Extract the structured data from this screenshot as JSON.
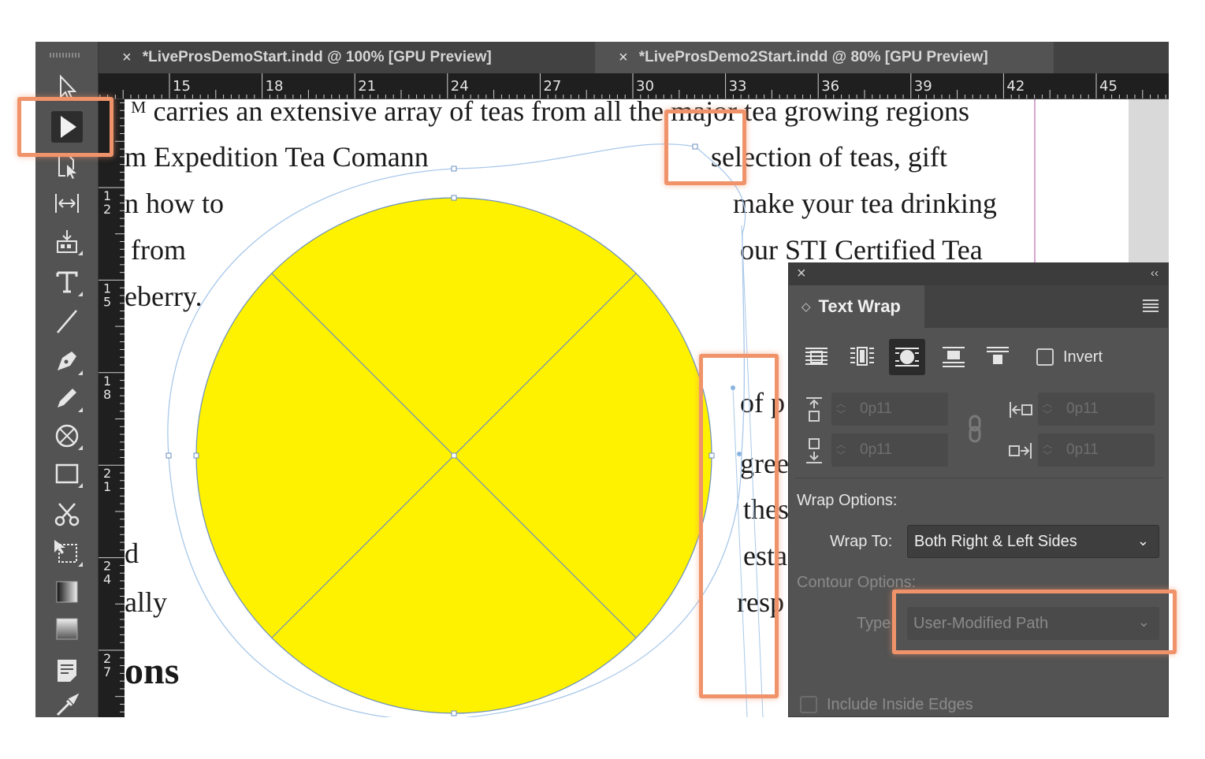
{
  "tabs": [
    {
      "label": "*LiveProsDemoStart.indd @ 100% [GPU Preview]",
      "active": false
    },
    {
      "label": "*LiveProsDemo2Start.indd @ 80% [GPU Preview]",
      "active": true
    }
  ],
  "ruler": {
    "h_labels": [
      "15",
      "18",
      "21",
      "24",
      "27",
      "30",
      "33",
      "36",
      "39",
      "42",
      "45"
    ],
    "v_labels": [
      [
        "1",
        "2"
      ],
      [
        "1",
        "5"
      ],
      [
        "1",
        "8"
      ],
      [
        "2",
        "1"
      ],
      [
        "2",
        "4"
      ],
      [
        "2",
        "7"
      ]
    ]
  },
  "tools": [
    {
      "name": "selection-tool",
      "icon": "hollow-arrow-icon"
    },
    {
      "name": "direct-selection-tool",
      "icon": "solid-arrow-icon",
      "active": true
    },
    {
      "name": "page-tool",
      "icon": "page-tool-icon"
    },
    {
      "name": "gap-tool",
      "icon": "gap-tool-icon"
    },
    {
      "name": "content-collector-tool",
      "icon": "content-collector-icon"
    },
    {
      "name": "type-tool",
      "icon": "type-icon"
    },
    {
      "name": "line-tool",
      "icon": "line-icon"
    },
    {
      "name": "pen-tool",
      "icon": "pen-icon"
    },
    {
      "name": "pencil-tool",
      "icon": "pencil-icon"
    },
    {
      "name": "frame-tool",
      "icon": "ellipse-frame-icon"
    },
    {
      "name": "rectangle-tool",
      "icon": "rectangle-icon"
    },
    {
      "name": "scissors-tool",
      "icon": "scissors-icon"
    },
    {
      "name": "free-transform-tool",
      "icon": "free-transform-icon"
    },
    {
      "name": "gradient-swatch-tool",
      "icon": "gradient-icon"
    },
    {
      "name": "gradient-feather-tool",
      "icon": "gradient-feather-icon"
    },
    {
      "name": "note-tool",
      "icon": "note-icon"
    },
    {
      "name": "eyedropper-tool",
      "icon": "eyedropper-icon"
    }
  ],
  "document": {
    "lines": [
      "ᴹ  carries an extensive array of teas from all the major tea growing regions",
      "m Expedition Tea Comann",
      "selection of teas, gift",
      "n how to",
      "make your tea drinking",
      "from",
      "our STI Certified Tea",
      "eberry.",
      "of p",
      "gree",
      "thes",
      "esta",
      "d",
      "resp",
      "ally",
      "ons"
    ]
  },
  "shape": {
    "fill_color": "#fff200",
    "path_color": "#8ab4e0"
  },
  "panel": {
    "title": "Text Wrap",
    "invert_label": "Invert",
    "offsets": {
      "top": "0p11",
      "bottom": "0p11",
      "left": "0p11",
      "right": "0p11"
    },
    "wrap_options_label": "Wrap Options:",
    "wrap_to_label": "Wrap To:",
    "wrap_to_value": "Both Right & Left Sides",
    "contour_options_label": "Contour Options:",
    "type_label": "Type:",
    "type_value": "User-Modified Path",
    "include_inside_edges_label": "Include Inside Edges",
    "wrap_buttons": [
      "no-text-wrap",
      "wrap-around-bounding-box",
      "wrap-around-object-shape",
      "jump-object",
      "jump-to-next-column"
    ],
    "selected_wrap": "wrap-around-object-shape"
  },
  "highlight_color": "#f0936a"
}
